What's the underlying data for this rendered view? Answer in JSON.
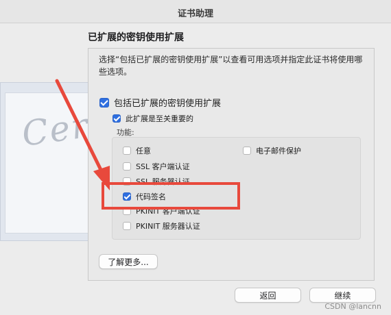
{
  "window": {
    "title": "证书助理"
  },
  "section": {
    "title": "已扩展的密钥使用扩展"
  },
  "description": "选择“包括已扩展的密钥使用扩展”以查看可用选项并指定此证书将使用哪些选项。",
  "options": {
    "include_ext": {
      "label": "包括已扩展的密钥使用扩展",
      "checked": true
    },
    "critical": {
      "label": "此扩展是至关重要的",
      "checked": true
    }
  },
  "functions": {
    "label": "功能:",
    "items": [
      {
        "label": "任意",
        "checked": false
      },
      {
        "label": "SSL 客户端认证",
        "checked": false
      },
      {
        "label": "SSL 服务器认证",
        "checked": false
      },
      {
        "label": "代码签名",
        "checked": true
      },
      {
        "label": "PKINIT 客户端认证",
        "checked": false
      },
      {
        "label": "PKINIT 服务器认证",
        "checked": false
      },
      {
        "label": "电子邮件保护",
        "checked": false
      }
    ]
  },
  "buttons": {
    "learn_more": "了解更多...",
    "back": "返回",
    "continue": "继续"
  },
  "watermark": "CSDN @lancnn",
  "colors": {
    "accent": "#2f6fe0",
    "annotation": "#e8493c"
  }
}
